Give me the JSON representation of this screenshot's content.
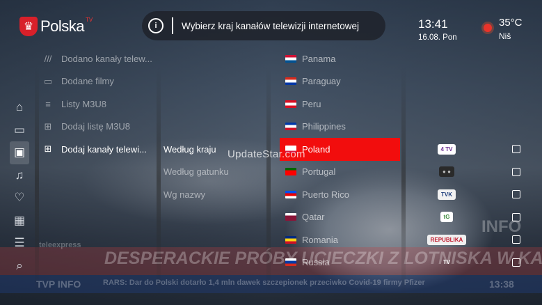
{
  "header": {
    "logo_text": "Polska",
    "logo_sup": "TV",
    "search_placeholder": "Wybierz kraj kanałów telewizji internetowej",
    "time": "13:41",
    "date": "16.08. Pon",
    "temperature": "35°C",
    "city": "Niš"
  },
  "rail": [
    {
      "icon": "home-icon",
      "glyph": "⌂",
      "active": false
    },
    {
      "icon": "tv-icon",
      "glyph": "▭",
      "active": false
    },
    {
      "icon": "live-tv-icon",
      "glyph": "▣",
      "active": true
    },
    {
      "icon": "radio-icon",
      "glyph": "♫",
      "active": false
    },
    {
      "icon": "favorites-icon",
      "glyph": "♡",
      "active": false
    },
    {
      "icon": "movies-icon",
      "glyph": "▦",
      "active": false
    },
    {
      "icon": "guide-icon",
      "glyph": "☰",
      "active": false
    },
    {
      "icon": "search-icon",
      "glyph": "⌕",
      "active": false
    }
  ],
  "menu": [
    {
      "label": "Dodano kanały telew...",
      "icon": "channels-list-icon",
      "glyph": "///",
      "active": false
    },
    {
      "label": "Dodane filmy",
      "icon": "film-icon",
      "glyph": "▭",
      "active": false
    },
    {
      "label": "Listy M3U8",
      "icon": "list-icon",
      "glyph": "≡",
      "active": false
    },
    {
      "label": "Dodaj listę M3U8",
      "icon": "add-list-icon",
      "glyph": "⊞",
      "active": false
    },
    {
      "label": "Dodaj kanały telewi...",
      "icon": "add-channel-icon",
      "glyph": "⊞",
      "active": true
    }
  ],
  "filters": [
    {
      "label": "Według kraju",
      "active": true
    },
    {
      "label": "Według gatunku",
      "active": false
    },
    {
      "label": "Wg nazwy",
      "active": false
    }
  ],
  "countries": [
    {
      "name": "Panama",
      "flag": "panama-flag",
      "colors": [
        "#d21034",
        "#ffffff",
        "#005293"
      ],
      "active": false
    },
    {
      "name": "Paraguay",
      "flag": "paraguay-flag",
      "colors": [
        "#d52b1e",
        "#ffffff",
        "#0038a8"
      ],
      "active": false
    },
    {
      "name": "Peru",
      "flag": "peru-flag",
      "colors": [
        "#d91023",
        "#ffffff",
        "#d91023"
      ],
      "active": false
    },
    {
      "name": "Philippines",
      "flag": "philippines-flag",
      "colors": [
        "#0038a8",
        "#ffffff",
        "#ce1126"
      ],
      "active": false
    },
    {
      "name": "Poland",
      "flag": "poland-flag",
      "colors": [
        "#ffffff",
        "#ffffff",
        "#dc143c"
      ],
      "active": true
    },
    {
      "name": "Portugal",
      "flag": "portugal-flag",
      "colors": [
        "#006600",
        "#ff0000",
        "#ff0000"
      ],
      "active": false
    },
    {
      "name": "Puerto Rico",
      "flag": "puerto-rico-flag",
      "colors": [
        "#0050f0",
        "#ed0000",
        "#ffffff"
      ],
      "active": false
    },
    {
      "name": "Qatar",
      "flag": "qatar-flag",
      "colors": [
        "#ffffff",
        "#8a1538",
        "#8a1538"
      ],
      "active": false
    },
    {
      "name": "Romania",
      "flag": "romania-flag",
      "colors": [
        "#002b7f",
        "#fcd116",
        "#ce1126"
      ],
      "active": false
    },
    {
      "name": "Russia",
      "flag": "russia-flag",
      "colors": [
        "#ffffff",
        "#0039a6",
        "#d52b1e"
      ],
      "active": false
    }
  ],
  "channels": [
    {
      "logo": "4fun-tv-logo",
      "text": "4 TV",
      "bg": "#ffffff",
      "fg": "#6a2c91"
    },
    {
      "logo": "round-channel-logo",
      "text": "● ●",
      "bg": "#2a2a2a",
      "fg": "#bbbbbb"
    },
    {
      "logo": "tvk-logo",
      "text": "TVK",
      "bg": "#f2f2f2",
      "fg": "#1b3b7a"
    },
    {
      "logo": "tg-logo",
      "text": "tG",
      "bg": "#ffffff",
      "fg": "#3a8a3a"
    },
    {
      "logo": "republika-logo",
      "text": "REPUBLIKA",
      "bg": "#f0f0f0",
      "fg": "#c0162a"
    },
    {
      "logo": "tv-trwam-logo",
      "text": "TV",
      "bg": "rgba(0,0,0,0)",
      "fg": "#ffffff"
    }
  ],
  "watermark": "UpdateStar.com",
  "background": {
    "headline": "DESPERACKIE PRÓBY UCIECZKI Z LOTNISKA W KABULU",
    "ticker": "RARS: Dar do Polski dotarło 1,4 mln dawek szczepionek przeciwko Covid-19 firmy Pfizer",
    "time": "13:38",
    "brand": "TVP INFO",
    "corner": "INFO",
    "program": "teleexpress"
  },
  "colors": {
    "accent": "#f20d0d",
    "search_bg": "#1e222a"
  }
}
